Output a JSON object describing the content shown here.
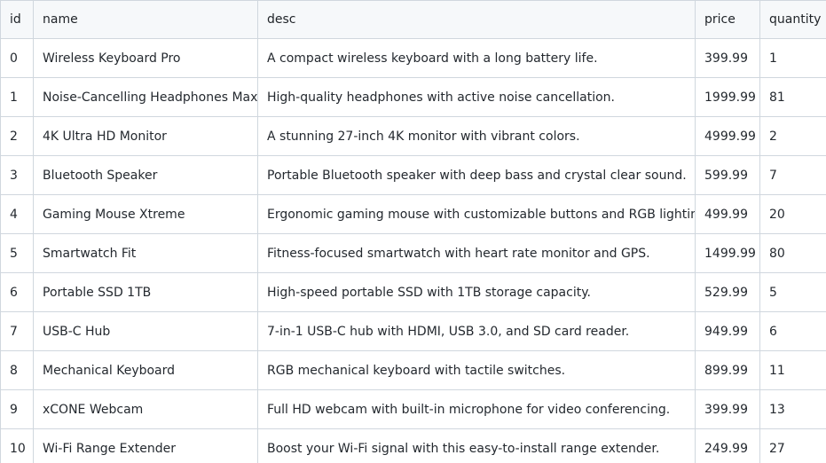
{
  "table": {
    "columns": [
      "id",
      "name",
      "desc",
      "price",
      "quantity"
    ],
    "rows": [
      {
        "id": "0",
        "name": "Wireless Keyboard Pro",
        "desc": "A compact wireless keyboard with a long battery life.",
        "price": "399.99",
        "quantity": "1"
      },
      {
        "id": "1",
        "name": "Noise-Cancelling Headphones Max",
        "desc": "High-quality headphones with active noise cancellation.",
        "price": "1999.99",
        "quantity": "81"
      },
      {
        "id": "2",
        "name": "4K Ultra HD Monitor",
        "desc": "A stunning 27-inch 4K monitor with vibrant colors.",
        "price": "4999.99",
        "quantity": "2"
      },
      {
        "id": "3",
        "name": "Bluetooth Speaker",
        "desc": "Portable Bluetooth speaker with deep bass and crystal clear sound.",
        "price": "599.99",
        "quantity": "7"
      },
      {
        "id": "4",
        "name": "Gaming Mouse Xtreme",
        "desc": "Ergonomic gaming mouse with customizable buttons and RGB lighting.",
        "price": "499.99",
        "quantity": "20"
      },
      {
        "id": "5",
        "name": "Smartwatch Fit",
        "desc": "Fitness-focused smartwatch with heart rate monitor and GPS.",
        "price": "1499.99",
        "quantity": "80"
      },
      {
        "id": "6",
        "name": "Portable SSD 1TB",
        "desc": "High-speed portable SSD with 1TB storage capacity.",
        "price": "529.99",
        "quantity": "5"
      },
      {
        "id": "7",
        "name": "USB-C Hub",
        "desc": "7-in-1 USB-C hub with HDMI, USB 3.0, and SD card reader.",
        "price": "949.99",
        "quantity": "6"
      },
      {
        "id": "8",
        "name": "Mechanical Keyboard",
        "desc": "RGB mechanical keyboard with tactile switches.",
        "price": "899.99",
        "quantity": "11"
      },
      {
        "id": "9",
        "name": "xCONE Webcam",
        "desc": "Full HD webcam with built-in microphone for video conferencing.",
        "price": "399.99",
        "quantity": "13"
      },
      {
        "id": "10",
        "name": "Wi-Fi Range Extender",
        "desc": "Boost your Wi-Fi signal with this easy-to-install range extender.",
        "price": "249.99",
        "quantity": "27"
      }
    ]
  }
}
